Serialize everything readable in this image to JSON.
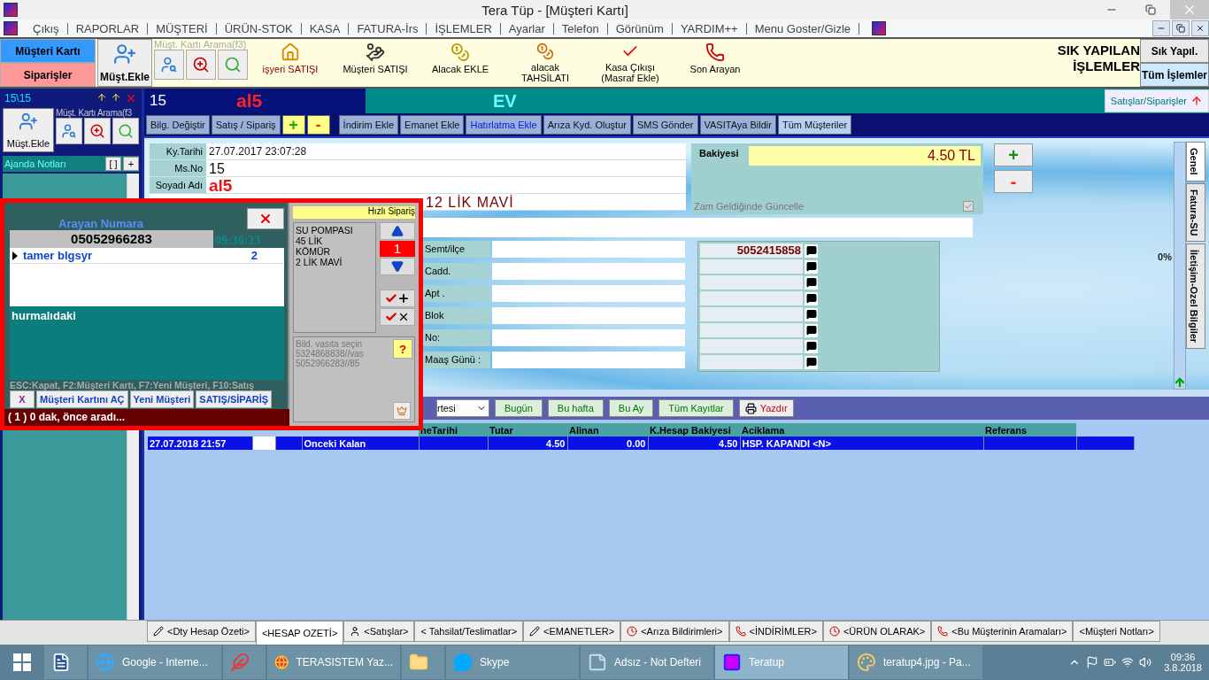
{
  "window": {
    "title": "Tera Tüp - [Müşteri Kartı]"
  },
  "menu": [
    "Çıkış",
    "RAPORLAR",
    "MÜŞTERİ",
    "ÜRÜN-STOK",
    "KASA",
    "FATURA-İrs",
    "İŞLEMLER",
    "Ayarlar",
    "Telefon",
    "Görünüm",
    "YARDIM++",
    "Menu Goster/Gizle"
  ],
  "toolbar": {
    "modes": [
      {
        "label": "Müşteri Kartı",
        "selected": true
      },
      {
        "label": "Siparişler",
        "selected": false
      }
    ],
    "add_button": "Müşt.Ekle",
    "search_label": "Müşt. Kartı Arama(f3)",
    "actions": [
      {
        "label": "işyeri SATIŞI",
        "kind": "shop"
      },
      {
        "label": "Müşteri SATIŞI",
        "kind": "sale"
      },
      {
        "label": "Alacak EKLE",
        "kind": "coin-add"
      },
      {
        "label": "alacak TAHSİLATI",
        "kind": "coin-remove"
      },
      {
        "label": "Kasa Çıkışı (Masraf Ekle)",
        "kind": "check"
      },
      {
        "label": "Son Arayan",
        "kind": "phone"
      }
    ],
    "quick_title": "SIK YAPILAN İŞLEMLER",
    "quick_tabs": [
      {
        "label": "Sık Yapıl.",
        "selected": false
      },
      {
        "label": "Tüm İşlemler",
        "selected": true
      }
    ]
  },
  "sidebar": {
    "counter": "15\\15",
    "search_label": "Müşt. Kartı Arama(f3",
    "add_button": "Müşt.Ekle",
    "agenda_title": "Ajanda Notları",
    "agenda_buttons": [
      "[ ]",
      "+"
    ]
  },
  "header": {
    "number": "15",
    "name": "al5",
    "type": "EV",
    "orders_button": "Satışlar/Siparişler"
  },
  "actions": [
    {
      "label": "Bilg. Değiştir",
      "kind": "text"
    },
    {
      "label": "Satış / Sipariş",
      "kind": "text"
    },
    {
      "label": "+",
      "kind": "plus"
    },
    {
      "label": "-",
      "kind": "minus"
    },
    {
      "label": "İndirim Ekle",
      "kind": "text"
    },
    {
      "label": "Emanet Ekle",
      "kind": "text"
    },
    {
      "label": "Hatırlatma Ekle",
      "kind": "link"
    },
    {
      "label": "Arıza Kyd. Oluştur",
      "kind": "text"
    },
    {
      "label": "SMS Gönder",
      "kind": "text"
    },
    {
      "label": "VASITAya Bildir",
      "kind": "text"
    },
    {
      "label": "Tüm Müşteriler",
      "kind": "light"
    }
  ],
  "fields": [
    {
      "label": "Ky.Tarihi",
      "value": "27.07.2017 23:07:28",
      "kind": "plain"
    },
    {
      "label": "Ms.No",
      "value": "15",
      "kind": "large"
    },
    {
      "label": "Soyadı Adı",
      "value": "al5",
      "kind": "name"
    },
    {
      "value": "12 LİK MAVİ",
      "kind": "note"
    }
  ],
  "balance": {
    "label": "Bakiyesi",
    "value": "4.50 TL",
    "update_label": "Zam Geldiğinde Güncelle",
    "update_checked": true,
    "buttons": [
      "+",
      "-"
    ]
  },
  "address": [
    {
      "label": "Semt/ilçe"
    },
    {
      "label": "Cadd."
    },
    {
      "label": "Apt ."
    },
    {
      "label": "Blok"
    },
    {
      "label": "No:"
    },
    {
      "label": "Maaş Günü :"
    }
  ],
  "phones": [
    "5052415858"
  ],
  "percent": "0%",
  "side_tabs": [
    {
      "label": "Genel",
      "selected": true
    },
    {
      "label": "Fatura-SU",
      "selected": false
    },
    {
      "label": "İletişim-Ozel Bilgiler",
      "selected": false
    }
  ],
  "filter": {
    "period": "rtesi",
    "buttons": [
      "Bugün",
      "Bu hafta",
      "Bu Ay",
      "Tüm Kayıtlar"
    ],
    "print_button": "Yazdır"
  },
  "table": {
    "columns": [
      "neTarihi",
      "Tutar",
      "Alinan",
      "K.Hesap Bakiyesi",
      "Aciklama",
      "Referans"
    ],
    "rows": [
      {
        "date": "27.07.2018 21:57",
        "type": "Onceki Kalan",
        "tutar": "4.50",
        "alinan": "0.00",
        "bakiye": "4.50",
        "aciklama": "HSP. KAPANDI <N>",
        "selected": true
      }
    ]
  },
  "popup": {
    "title": "Arayan Numara",
    "number": "05052966283",
    "time": "09:36:23",
    "callers": [
      {
        "name": "tamer blgsyr",
        "count": "2",
        "selected": true
      }
    ],
    "note": "hurmalıdaki",
    "hint": "ESC:Kapat,  F2:Müşteri Kartı,  F7:Yeni Müşteri,  F10:Satış",
    "buttons": [
      "X",
      "Müşteri Kartını AÇ",
      "Yeni Müşteri",
      "SATIŞ/SİPARİŞ"
    ],
    "status": "( 1 ) 0 dak, önce aradı...",
    "order_title": "Hızlı Sipariş",
    "order_items": [
      "SU POMPASI",
      "45 LİK",
      "KÖMÜR",
      "2 LİK MAVİ"
    ],
    "quantity": "1",
    "vehicle_text": [
      "Bild. vasıta seçin",
      "5324868838//vas",
      "5052966283//85"
    ],
    "help": "?"
  },
  "bottom_tabs": [
    {
      "label": "<Dty Hesap Özeti>",
      "kind": "pen",
      "selected": false
    },
    {
      "label": "<HESAP OZETİ>",
      "kind": "none",
      "selected": true
    },
    {
      "label": "<Satışlar>",
      "kind": "person",
      "selected": false
    },
    {
      "label": "< Tahsilat/Teslimatlar>",
      "kind": "none",
      "selected": false
    },
    {
      "label": "<EMANETLER>",
      "kind": "pen",
      "selected": false
    },
    {
      "label": "<Arıza Bildirimleri>",
      "kind": "clock",
      "selected": false
    },
    {
      "label": "<İNDİRİMLER>",
      "kind": "phone",
      "selected": false
    },
    {
      "label": "<ÜRÜN OLARAK>",
      "kind": "clock",
      "selected": false
    },
    {
      "label": "<Bu Müşterinin Aramaları>",
      "kind": "phone",
      "selected": false
    },
    {
      "label": "<Müşteri Notları>",
      "kind": "none",
      "selected": false
    }
  ],
  "taskbar": {
    "items": [
      {
        "kind": "word",
        "selected": false
      },
      {
        "label": "Google - Interne...",
        "kind": "ie",
        "selected": false
      },
      {
        "kind": "red",
        "selected": false
      },
      {
        "label": "TERASISTEM Yaz...",
        "kind": "chrome",
        "selected": false
      },
      {
        "kind": "folder",
        "selected": false
      },
      {
        "label": "Skype",
        "kind": "skype",
        "selected": false
      },
      {
        "label": "Adsız - Not Defteri",
        "kind": "notepad",
        "selected": false
      },
      {
        "label": "Teratup",
        "kind": "app",
        "selected": true
      },
      {
        "label": "teratup4.jpg - Pa...",
        "kind": "paint",
        "selected": false
      }
    ],
    "time": "09:36",
    "date": "3.8.2018"
  }
}
